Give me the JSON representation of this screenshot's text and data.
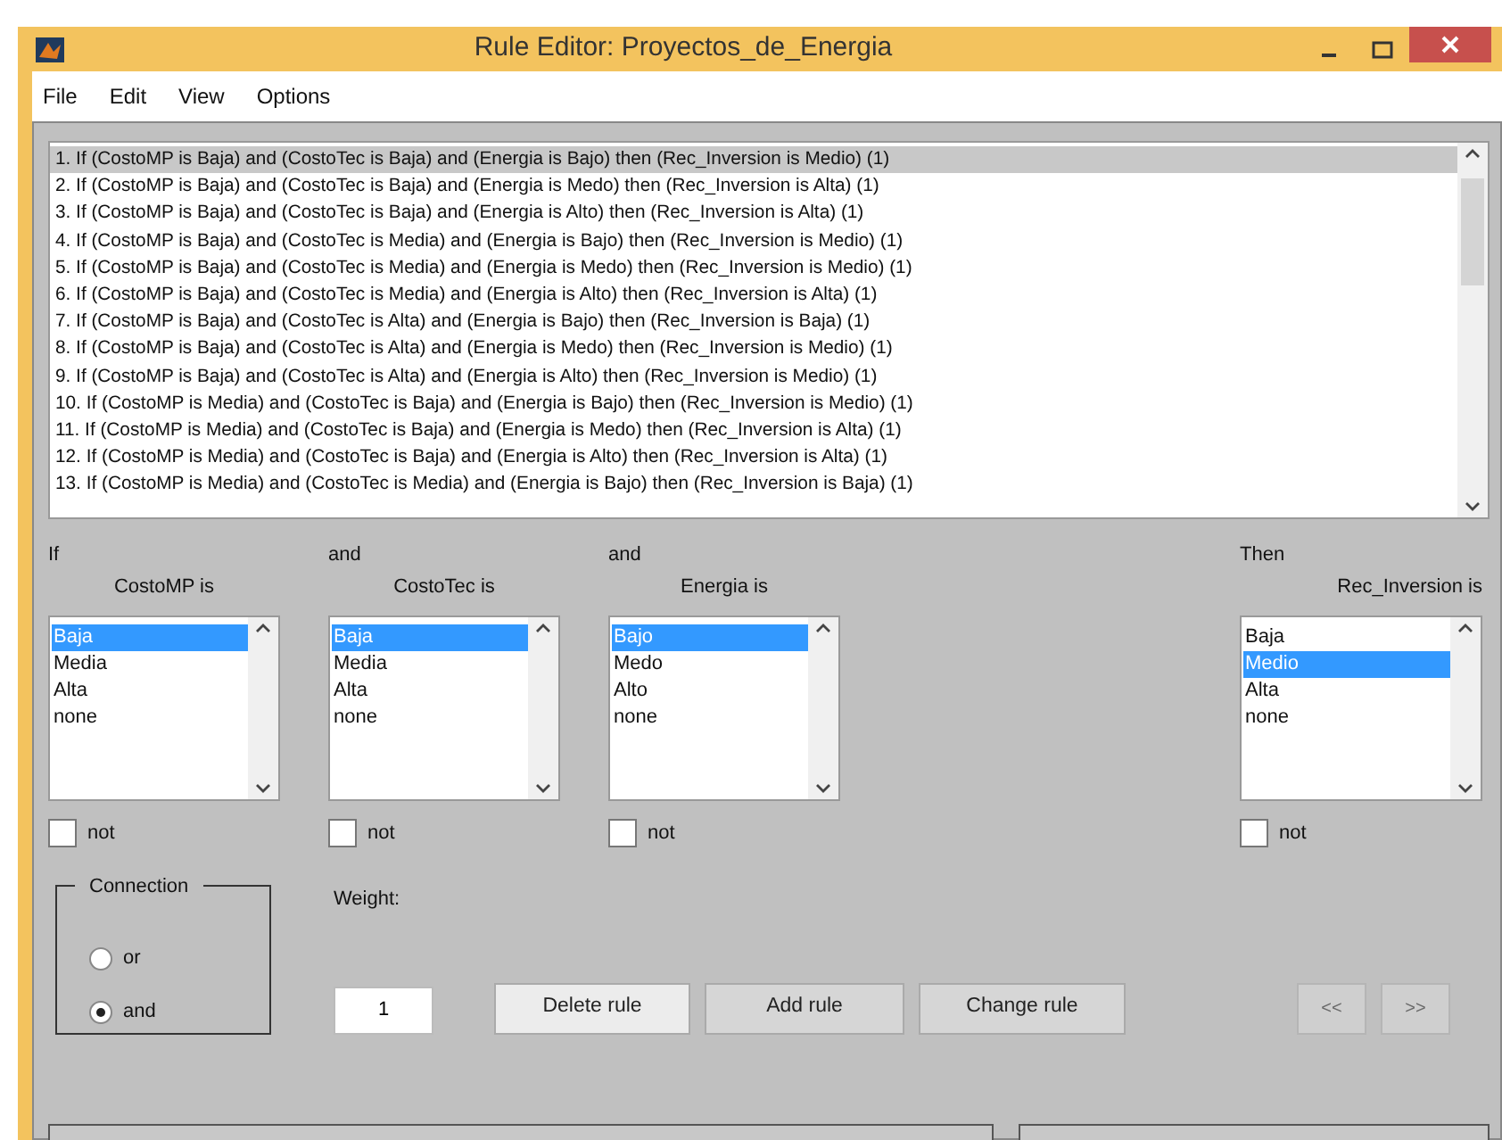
{
  "window": {
    "title": "Rule Editor: Proyectos_de_Energia"
  },
  "menu": [
    "File",
    "Edit",
    "View",
    "Options"
  ],
  "rules": [
    {
      "text": "1. If (CostoMP is Baja) and (CostoTec is Baja) and (Energia is Bajo) then (Rec_Inversion is Medio) (1)",
      "selected": true
    },
    {
      "text": "2. If (CostoMP is Baja) and (CostoTec is Baja) and (Energia is Medo) then (Rec_Inversion is Alta) (1)",
      "selected": false
    },
    {
      "text": "3. If (CostoMP is Baja) and (CostoTec is Baja) and (Energia is Alto) then (Rec_Inversion is Alta) (1)",
      "selected": false
    },
    {
      "text": "4. If (CostoMP is Baja) and (CostoTec is Media) and (Energia is Bajo) then (Rec_Inversion is Medio) (1)",
      "selected": false
    },
    {
      "text": "5. If (CostoMP is Baja) and (CostoTec is Media) and (Energia is Medo) then (Rec_Inversion is Medio) (1)",
      "selected": false
    },
    {
      "text": "6. If (CostoMP is Baja) and (CostoTec is Media) and (Energia is Alto) then (Rec_Inversion is Alta) (1)",
      "selected": false
    },
    {
      "text": "7. If (CostoMP is Baja) and (CostoTec is Alta) and (Energia is Bajo) then (Rec_Inversion is Baja) (1)",
      "selected": false
    },
    {
      "text": "8. If (CostoMP is Baja) and (CostoTec is Alta) and (Energia is Medo) then (Rec_Inversion is Medio) (1)",
      "selected": false
    },
    {
      "text": "9. If (CostoMP is Baja) and (CostoTec is Alta) and (Energia is Alto) then (Rec_Inversion is Medio) (1)",
      "selected": false
    },
    {
      "text": "10. If (CostoMP is Media) and (CostoTec is Baja) and (Energia is Bajo) then (Rec_Inversion is Medio) (1)",
      "selected": false
    },
    {
      "text": "11. If (CostoMP is Media) and (CostoTec is Baja) and (Energia is Medo) then (Rec_Inversion is Alta) (1)",
      "selected": false
    },
    {
      "text": "12. If (CostoMP is Media) and (CostoTec is Baja) and (Energia is Alto) then (Rec_Inversion is Alta) (1)",
      "selected": false
    },
    {
      "text": "13. If (CostoMP is Media) and (CostoTec is Media) and (Energia is Bajo) then (Rec_Inversion is Baja) (1)",
      "selected": false
    }
  ],
  "variables": [
    {
      "kind": "input",
      "connector": "If",
      "label": "CostoMP is",
      "not_label": "not",
      "not": false,
      "options": [
        {
          "label": "Baja",
          "selected": true
        },
        {
          "label": "Media",
          "selected": false
        },
        {
          "label": "Alta",
          "selected": false
        },
        {
          "label": "none",
          "selected": false
        }
      ]
    },
    {
      "kind": "input",
      "connector": "and",
      "label": "CostoTec is",
      "not_label": "not",
      "not": false,
      "options": [
        {
          "label": "Baja",
          "selected": true
        },
        {
          "label": "Media",
          "selected": false
        },
        {
          "label": "Alta",
          "selected": false
        },
        {
          "label": "none",
          "selected": false
        }
      ]
    },
    {
      "kind": "input",
      "connector": "and",
      "label": "Energia is",
      "not_label": "not",
      "not": false,
      "options": [
        {
          "label": "Bajo",
          "selected": true
        },
        {
          "label": "Medo",
          "selected": false
        },
        {
          "label": "Alto",
          "selected": false
        },
        {
          "label": "none",
          "selected": false
        }
      ]
    },
    {
      "kind": "output",
      "connector": "Then",
      "label": "Rec_Inversion is",
      "not_label": "not",
      "not": false,
      "options": [
        {
          "label": "Baja",
          "selected": false
        },
        {
          "label": "Medio",
          "selected": true
        },
        {
          "label": "Alta",
          "selected": false
        },
        {
          "label": "none",
          "selected": false
        }
      ]
    }
  ],
  "connection": {
    "label": "Connection",
    "options": [
      {
        "label": "or",
        "selected": false
      },
      {
        "label": "and",
        "selected": true
      }
    ]
  },
  "weight": {
    "label": "Weight:",
    "value": "1"
  },
  "buttons": [
    {
      "label": "Delete rule",
      "disabled": false
    },
    {
      "label": "Add rule",
      "disabled": false
    },
    {
      "label": "Change rule",
      "disabled": false
    }
  ],
  "nav_buttons": [
    {
      "label": "<<",
      "disabled": true
    },
    {
      "label": ">>",
      "disabled": true
    }
  ]
}
